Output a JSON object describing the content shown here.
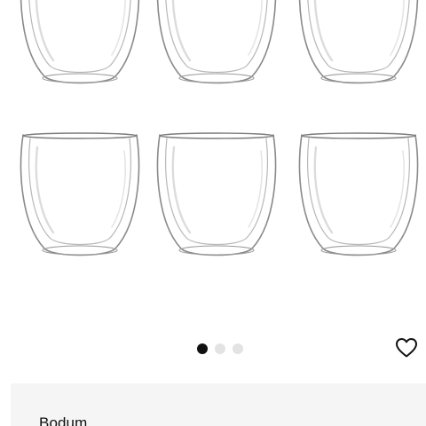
{
  "product": {
    "brand": "Bodum"
  },
  "gallery": {
    "dots": [
      {
        "active": true
      },
      {
        "active": false
      },
      {
        "active": false
      }
    ]
  },
  "icons": {
    "wishlist": "heart-outline-icon"
  },
  "colors": {
    "dot_active": "#111111",
    "dot_inactive": "#e3e3e3",
    "card_background": "#f5f5f5"
  }
}
